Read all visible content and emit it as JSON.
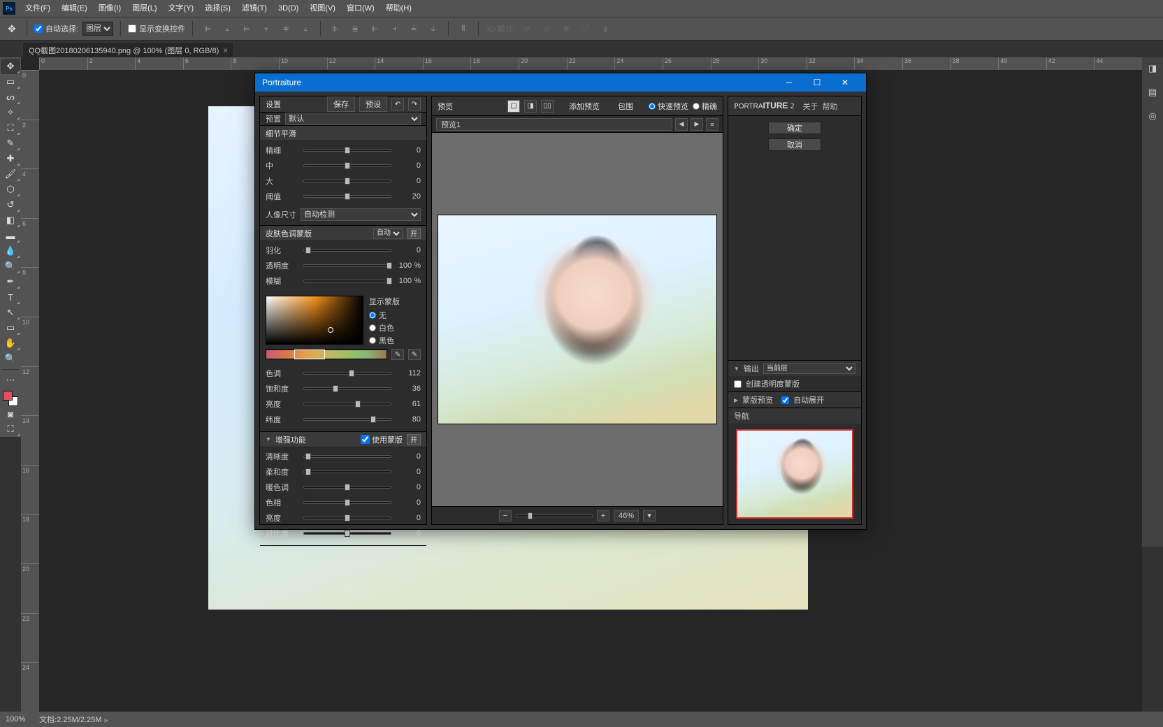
{
  "menubar": {
    "items": [
      "文件(F)",
      "编辑(E)",
      "图像(I)",
      "图层(L)",
      "文字(Y)",
      "选择(S)",
      "滤镜(T)",
      "3D(D)",
      "视图(V)",
      "窗口(W)",
      "帮助(H)"
    ]
  },
  "optbar": {
    "autosel_label": "自动选择:",
    "layer_select": "图层",
    "show_ctrl": "显示变换控件",
    "mode3d": "3D 模式:"
  },
  "doc_tab": {
    "title": "QQ截图20180206135940.png @ 100% (图层 0, RGB/8)"
  },
  "statusbar": {
    "zoom": "100%",
    "doc": "文档:2.25M/2.25M"
  },
  "ruler_h": [
    "0",
    "2",
    "4",
    "6",
    "8",
    "10",
    "12",
    "14",
    "16",
    "18",
    "20",
    "22",
    "24",
    "26",
    "28",
    "30",
    "32",
    "34",
    "36",
    "38",
    "40",
    "42",
    "44"
  ],
  "ruler_v": [
    "0",
    "2",
    "4",
    "6",
    "8",
    "10",
    "12",
    "14",
    "16",
    "18",
    "20",
    "22",
    "24"
  ],
  "dlg": {
    "title": "Portraiture",
    "left_header": {
      "settings": "设置",
      "save": "保存",
      "preset_btn": "预设"
    },
    "preset": {
      "label": "预置",
      "value": "默认"
    },
    "detail": {
      "title": "细节平滑",
      "sliders": [
        {
          "label": "精细",
          "value": 0,
          "pos": 50
        },
        {
          "label": "中",
          "value": 0,
          "pos": 50
        },
        {
          "label": "大",
          "value": 0,
          "pos": 50
        },
        {
          "label": "阈值",
          "value": 20,
          "pos": 50
        }
      ],
      "portrait_size_label": "人像尺寸",
      "portrait_size_value": "自动检测"
    },
    "skin": {
      "title": "皮肤色调蒙版",
      "auto": "自动",
      "on": "开",
      "sliders_top": [
        {
          "label": "羽化",
          "value": 0,
          "pos": 5
        },
        {
          "label": "透明度",
          "value": "100  %",
          "pos": 98
        },
        {
          "label": "模糊",
          "value": "100  %",
          "pos": 98
        }
      ],
      "mask_title": "显示蒙版",
      "mask_opts": [
        "无",
        "白色",
        "黑色"
      ],
      "sliders_bot": [
        {
          "label": "色调",
          "value": 112,
          "pos": 55
        },
        {
          "label": "饱和度",
          "value": 36,
          "pos": 36
        },
        {
          "label": "亮度",
          "value": 61,
          "pos": 62
        },
        {
          "label": "纬度",
          "value": 80,
          "pos": 80
        }
      ]
    },
    "enhance": {
      "title": "增强功能",
      "use_mask": "使用蒙版",
      "on": "开",
      "sliders": [
        {
          "label": "清晰度",
          "value": 0,
          "pos": 5
        },
        {
          "label": "柔和度",
          "value": 0,
          "pos": 5
        },
        {
          "label": "暖色调",
          "value": 0,
          "pos": 50
        },
        {
          "label": "色相",
          "value": 0,
          "pos": 50
        },
        {
          "label": "亮度",
          "value": 0,
          "pos": 50
        },
        {
          "label": "对比度",
          "value": 0,
          "pos": 50
        }
      ]
    },
    "mid_header": {
      "preview": "预览",
      "add_preview": "添加预览",
      "include": "包围",
      "quick": "快速预览",
      "precise": "精确"
    },
    "preset_tab": "预览1",
    "zoom": "46%",
    "right": {
      "brand": "Portraiture 2",
      "about": "关于",
      "help": "帮助",
      "ok": "确定",
      "cancel": "取消",
      "output": {
        "label": "输出",
        "value": "当前层",
        "opacity": "创建透明度蒙版"
      },
      "mask_prev": {
        "label": "蒙版预览",
        "auto": "自动展开"
      },
      "nav": "导航"
    }
  }
}
